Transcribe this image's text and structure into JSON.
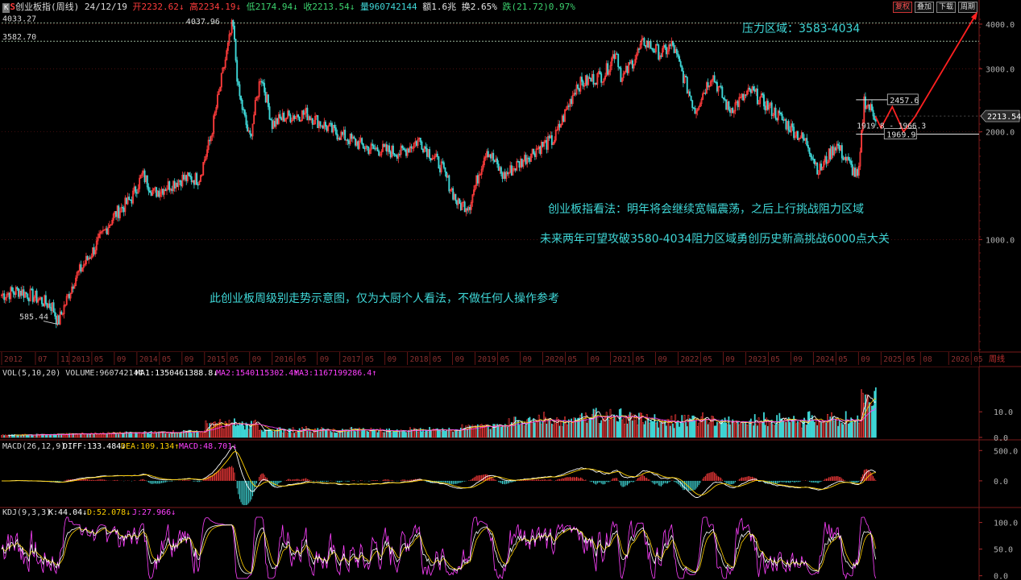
{
  "header": {
    "code_badge": "K",
    "indicator": "S",
    "title": "创业板指(周线) 24/12/19",
    "open": "开2232.62↓",
    "high": "高2234.19↓",
    "low": "低2174.94↓",
    "close": "收2213.54↓",
    "volume": "量960742144",
    "amount": "额1.6兆",
    "turnover": "换2.65%",
    "change": "跌(21.72)0.97%",
    "buttons": [
      "复权",
      "叠加",
      "下载",
      "周期"
    ]
  },
  "colors": {
    "up": "#ff3c3c",
    "down": "#3fd7d7",
    "text": "#d8d8d8",
    "annotation": "#3fd7d7",
    "grid": "#7a1a1a",
    "dashed_level": "#b0d0b0",
    "arrow": "#ff2020",
    "ma1": "#ffffff",
    "ma2": "#ffd000",
    "ma3": "#ff40ff"
  },
  "chart_data": [
    {
      "type": "candlestick",
      "name": "price",
      "y_axis_ticks": [
        "4000.0",
        "3000.0",
        "2000.0",
        "1000.0"
      ],
      "ylim": [
        500,
        4300
      ],
      "x_tick_labels": [
        "2012",
        "07",
        "11",
        "2013",
        "05",
        "09",
        "2014",
        "05",
        "09",
        "2015",
        "05",
        "09",
        "2016",
        "05",
        "09",
        "2017",
        "05",
        "09",
        "2018",
        "05",
        "09",
        "2019",
        "05",
        "09",
        "2020",
        "05",
        "09",
        "2021",
        "05",
        "09",
        "2022",
        "05",
        "09",
        "2023",
        "05",
        "09",
        "2024",
        "05",
        "09",
        "2025",
        "05",
        "08",
        "2026",
        "05"
      ],
      "x_axis_period_label": "周线",
      "key_points": [
        {
          "date": "2012-11",
          "price": 585.44,
          "label": "585.44"
        },
        {
          "date": "2015-06",
          "price": 4037.96,
          "label": "4037.96"
        },
        {
          "date": "2021-07",
          "price": 3576
        },
        {
          "date": "2024-09",
          "price": 1480
        },
        {
          "date": "2024-10",
          "price": 2457.6
        }
      ],
      "levels": [
        {
          "value": 4033.27,
          "label": "4033.27",
          "style": "dashed"
        },
        {
          "value": 3582.7,
          "label": "3582.70",
          "style": "dashed"
        },
        {
          "value": 2457.6,
          "label": "2457.6",
          "style": "box"
        },
        {
          "value": 1969.9,
          "label": "1969.9",
          "style": "box"
        }
      ],
      "range_label": "1919.8 - 1966.3",
      "current_price": "2213.54",
      "annotations": [
        "压力区域：3583-4034",
        "创业板指看法：明年将会继续宽幅震荡，之后上行挑战阻力区域",
        "未来两年可望攻破3580-4034阻力区域勇创历史新高挑战6000点大关",
        "此创业板周级别走势示意图，仅为大厨个人看法，不做任何人操作参考"
      ],
      "close_path": [
        [
          "2012-01",
          700
        ],
        [
          "2012-04",
          720
        ],
        [
          "2012-07",
          690
        ],
        [
          "2012-10",
          650
        ],
        [
          "2012-11",
          585
        ],
        [
          "2013-02",
          780
        ],
        [
          "2013-05",
          920
        ],
        [
          "2013-09",
          1170
        ],
        [
          "2013-12",
          1300
        ],
        [
          "2014-02",
          1520
        ],
        [
          "2014-04",
          1350
        ],
        [
          "2014-09",
          1480
        ],
        [
          "2014-12",
          1480
        ],
        [
          "2015-02",
          1900
        ],
        [
          "2015-04",
          2800
        ],
        [
          "2015-06",
          4037
        ],
        [
          "2015-07",
          2600
        ],
        [
          "2015-09",
          1900
        ],
        [
          "2015-11",
          2900
        ],
        [
          "2016-01",
          2100
        ],
        [
          "2016-03",
          2200
        ],
        [
          "2016-07",
          2250
        ],
        [
          "2016-12",
          2000
        ],
        [
          "2017-06",
          1800
        ],
        [
          "2017-12",
          1750
        ],
        [
          "2018-03",
          1900
        ],
        [
          "2018-07",
          1600
        ],
        [
          "2018-10",
          1250
        ],
        [
          "2018-12",
          1250
        ],
        [
          "2019-03",
          1800
        ],
        [
          "2019-06",
          1500
        ],
        [
          "2019-12",
          1800
        ],
        [
          "2020-03",
          1900
        ],
        [
          "2020-07",
          2700
        ],
        [
          "2020-12",
          2900
        ],
        [
          "2021-02",
          3400
        ],
        [
          "2021-03",
          2800
        ],
        [
          "2021-07",
          3576
        ],
        [
          "2021-10",
          3300
        ],
        [
          "2021-12",
          3500
        ],
        [
          "2022-04",
          2300
        ],
        [
          "2022-07",
          2900
        ],
        [
          "2022-10",
          2300
        ],
        [
          "2023-02",
          2600
        ],
        [
          "2023-07",
          2200
        ],
        [
          "2023-12",
          1850
        ],
        [
          "2024-02",
          1550
        ],
        [
          "2024-05",
          1850
        ],
        [
          "2024-09",
          1480
        ],
        [
          "2024-10",
          2450
        ],
        [
          "2024-12",
          2213
        ]
      ],
      "projection": [
        [
          "2024-12",
          2213
        ],
        [
          "2025-01",
          2050
        ],
        [
          "2025-03",
          2350
        ],
        [
          "2025-05",
          2000
        ],
        [
          "2025-07",
          2200
        ],
        [
          "2026-06",
          4300
        ]
      ]
    },
    {
      "type": "bar",
      "name": "volume",
      "label": "VOL(5,10,20) VOLUME:960742144",
      "ma1": "MA1:1350461388.8↓",
      "ma2": "MA2:1540115302.4↑",
      "ma3": "MA3:1167199286.4↑",
      "y_axis_ticks": [
        "10.0",
        "0.0"
      ],
      "ylim": [
        0,
        22
      ]
    },
    {
      "type": "line",
      "name": "macd",
      "label": "MACD(26,12,9)",
      "diff": "DIFF:133.484↓",
      "dea": "DEA:109.134↑",
      "macd": "MACD:48.701↓",
      "y_axis_ticks": [
        "500.0",
        "0.0"
      ],
      "ylim": [
        -400,
        650
      ]
    },
    {
      "type": "line",
      "name": "kdj",
      "label": "KDJ(9,3,3)",
      "k": "K:44.04↓",
      "d": "D:52.078↓",
      "j": "J:27.966↓",
      "y_axis_ticks": [
        "100.0",
        "50.0",
        "0.0"
      ],
      "ylim": [
        -5,
        110
      ]
    }
  ]
}
